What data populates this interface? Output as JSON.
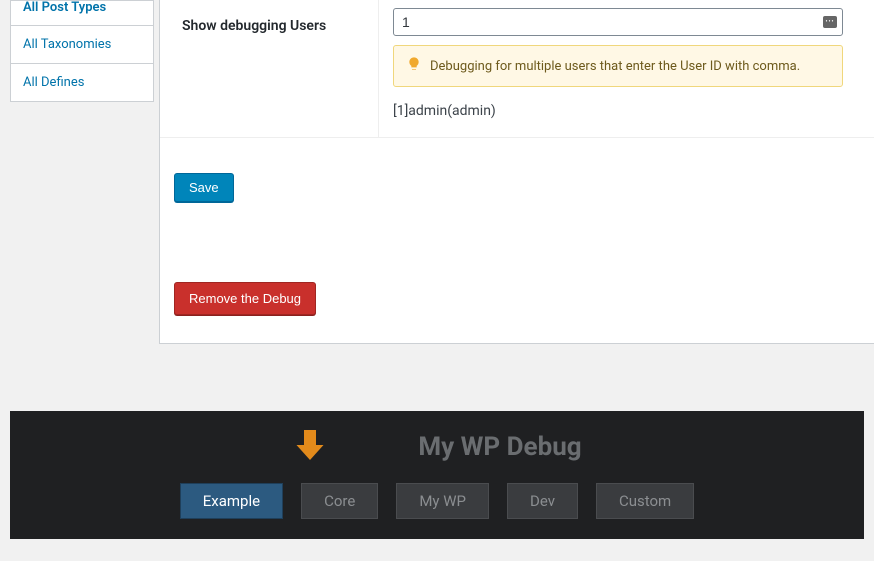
{
  "sidebar": {
    "items": [
      {
        "label": "All Post Types"
      },
      {
        "label": "All Taxonomies"
      },
      {
        "label": "All Defines"
      }
    ]
  },
  "form": {
    "row_label": "Show debugging Users",
    "user_input_value": "1",
    "notice": "Debugging for multiple users that enter the User ID with comma.",
    "user_line": "[1]admin(admin)",
    "save_label": "Save",
    "remove_label": "Remove the Debug"
  },
  "debug_bar": {
    "title": "My WP Debug",
    "tabs": [
      {
        "label": "Example",
        "active": true
      },
      {
        "label": "Core",
        "active": false
      },
      {
        "label": "My WP",
        "active": false
      },
      {
        "label": "Dev",
        "active": false
      },
      {
        "label": "Custom",
        "active": false
      }
    ]
  }
}
